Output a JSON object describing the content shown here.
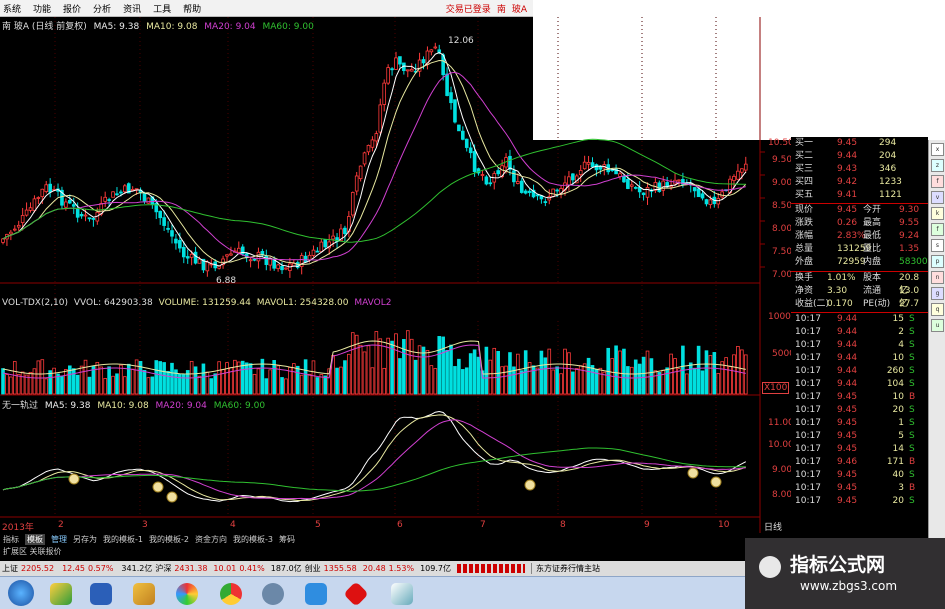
{
  "menu": {
    "items": [
      "系统",
      "功能",
      "报价",
      "分析",
      "资讯",
      "工具",
      "帮助"
    ],
    "login": "交易已登录",
    "stock": "南",
    "stock2": "玻A"
  },
  "main": {
    "header_prefix": "南 玻A (日线 前复权)",
    "ma5": "MA5: 9.38",
    "ma10": "MA10: 9.08",
    "ma20": "MA20: 9.04",
    "ma60": "MA60: 9.00",
    "high_label": "12.06",
    "low_label": "6.88",
    "axis": [
      "10.50",
      "9.50",
      "9.00",
      "8.50",
      "8.00",
      "7.50",
      "7.00"
    ]
  },
  "vol": {
    "header1": "VOL-TDX(2,10)",
    "header2": "VVOL: 642903.38",
    "header3": "VOLUME: 131259.44",
    "header4": "MAVOL1: 254328.00",
    "header5": "MAVOL2",
    "axis": [
      "10000",
      "5000",
      "X100"
    ]
  },
  "ind": {
    "header_name": "无一轨过",
    "ma5": "MA5: 9.38",
    "ma10": "MA10: 9.08",
    "ma20": "MA20: 9.04",
    "ma60": "MA60: 9.00",
    "axis": [
      "11.00",
      "10.00",
      "9.00",
      "8.00"
    ]
  },
  "dates": {
    "items": [
      "2013年",
      "2",
      "3",
      "4",
      "5",
      "6",
      "7",
      "8",
      "9",
      "10"
    ],
    "period": "日线"
  },
  "quotes": {
    "buy": [
      {
        "label": "买一",
        "price": "9.45",
        "vol": "294"
      },
      {
        "label": "买二",
        "price": "9.44",
        "vol": "204"
      },
      {
        "label": "买三",
        "price": "9.43",
        "vol": "346"
      },
      {
        "label": "买四",
        "price": "9.42",
        "vol": "1233"
      },
      {
        "label": "买五",
        "price": "9.41",
        "vol": "1121"
      }
    ],
    "stats": [
      {
        "l1": "现价",
        "v1": "9.45",
        "l2": "今开",
        "v2": "9.30"
      },
      {
        "l1": "涨跌",
        "v1": "0.26",
        "l2": "最高",
        "v2": "9.55"
      },
      {
        "l1": "涨幅",
        "v1": "2.83%",
        "l2": "最低",
        "v2": "9.24"
      },
      {
        "l1": "总量",
        "v1": "131259",
        "l2": "量比",
        "v2": "1.35"
      },
      {
        "l1": "外盘",
        "v1": "72959",
        "l2": "内盘",
        "v2": "58300"
      }
    ],
    "stats2": [
      {
        "l1": "换手",
        "v1": "1.01%",
        "l2": "股本",
        "v2": "20.8亿"
      },
      {
        "l1": "净资",
        "v1": "3.30",
        "l2": "流通",
        "v2": "13.0亿"
      },
      {
        "l1": "收益(二)",
        "v1": "0.170",
        "l2": "PE(动)",
        "v2": "27.7"
      }
    ],
    "ticks": [
      {
        "t": "10:17",
        "p": "9.44",
        "v": "15",
        "s": "S"
      },
      {
        "t": "10:17",
        "p": "9.44",
        "v": "2",
        "s": "S"
      },
      {
        "t": "10:17",
        "p": "9.44",
        "v": "4",
        "s": "S"
      },
      {
        "t": "10:17",
        "p": "9.44",
        "v": "10",
        "s": "S"
      },
      {
        "t": "10:17",
        "p": "9.44",
        "v": "260",
        "s": "S"
      },
      {
        "t": "10:17",
        "p": "9.44",
        "v": "104",
        "s": "S"
      },
      {
        "t": "10:17",
        "p": "9.45",
        "v": "10",
        "s": "B"
      },
      {
        "t": "10:17",
        "p": "9.45",
        "v": "20",
        "s": "S"
      },
      {
        "t": "10:17",
        "p": "9.45",
        "v": "1",
        "s": "S"
      },
      {
        "t": "10:17",
        "p": "9.45",
        "v": "5",
        "s": "S"
      },
      {
        "t": "10:17",
        "p": "9.45",
        "v": "14",
        "s": "S"
      },
      {
        "t": "10:17",
        "p": "9.46",
        "v": "171",
        "s": "B"
      },
      {
        "t": "10:17",
        "p": "9.45",
        "v": "40",
        "s": "S"
      },
      {
        "t": "10:17",
        "p": "9.45",
        "v": "3",
        "s": "B"
      },
      {
        "t": "10:17",
        "p": "9.45",
        "v": "20",
        "s": "S"
      }
    ]
  },
  "tabs": {
    "items": [
      "指标",
      "模板",
      "管理",
      "另存为",
      "我的模板-1",
      "我的模板-2",
      "资金方向",
      "我的模板-3",
      "筹码"
    ],
    "row2": "扩展区  关联报价"
  },
  "status": {
    "sh_name": "上证",
    "sh_val": "2205.52",
    "sh_chg": "12.45",
    "sh_pct": "0.57%",
    "sh_amt": "341.2亿",
    "hs_name": "沪深",
    "hs_val": "2431.38",
    "hs_chg": "10.01",
    "hs_pct": "0.41%",
    "hs_amt": "187.0亿",
    "cy_name": "创业",
    "cy_val": "1355.58",
    "cy_chg": "20.48",
    "cy_pct": "1.53%",
    "cy_amt": "109.7亿",
    "broker": "东方证券行情主站"
  },
  "watermark": {
    "title": "指标公式网",
    "url": "www.zbgs3.com"
  },
  "sidebar_icons": [
    "x",
    "z",
    "f",
    "v",
    "k",
    "f",
    "s",
    "p",
    "n",
    "g",
    "q",
    "u"
  ]
}
